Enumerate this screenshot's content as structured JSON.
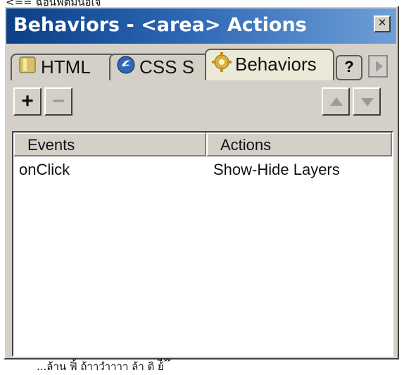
{
  "annotations": {
    "top": "<== ฉอนฟิตมินอเจ",
    "bottom": "...ล้าน ฟิ้ ถ้าาวำาาา ล้า ติ ย้ี ้ ้"
  },
  "window": {
    "title": "Behaviors - <area> Actions",
    "close_label": "×"
  },
  "tabs": [
    {
      "label": "HTML",
      "icon": "html-icon"
    },
    {
      "label": "CSS S",
      "icon": "css-icon"
    },
    {
      "label": "Behaviors",
      "icon": "behaviors-gear-icon"
    }
  ],
  "toolbar": {
    "add_label": "+",
    "remove_label": "−"
  },
  "table": {
    "columns": [
      "Events",
      "Actions"
    ],
    "rows": [
      {
        "event": "onClick",
        "action": "Show-Hide Layers"
      }
    ]
  },
  "colors": {
    "title_gradient_start": "#0b3f86",
    "title_gradient_end": "#6f9fd8",
    "panel": "#d4d0c8"
  }
}
